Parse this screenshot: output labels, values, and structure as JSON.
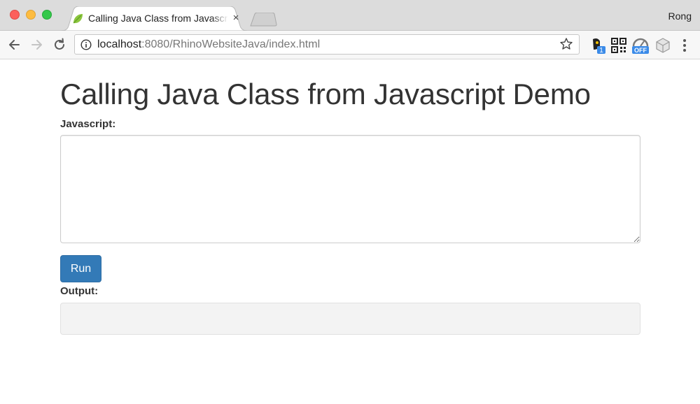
{
  "browser": {
    "tab_title": "Calling Java Class from Javascript Demo",
    "tab_close": "×",
    "profile_name": "Rong",
    "url_host": "localhost",
    "url_rest": ":8080/RhinoWebsiteJava/index.html",
    "extensions": [
      {
        "icon": "extension-badge-icon",
        "badge": "1"
      },
      {
        "icon": "qr-code-icon"
      },
      {
        "icon": "speedometer-off-icon",
        "badge": "OFF"
      },
      {
        "icon": "cube-extension-icon"
      },
      {
        "icon": "menu-kebab-icon"
      }
    ]
  },
  "page": {
    "heading": "Calling Java Class from Javascript Demo",
    "javascript_label": "Javascript:",
    "javascript_value": "",
    "run_label": "Run",
    "output_label": "Output:",
    "output_value": ""
  },
  "colors": {
    "primary_button": "#337ab7",
    "titlebar": "#dcdcdc"
  }
}
